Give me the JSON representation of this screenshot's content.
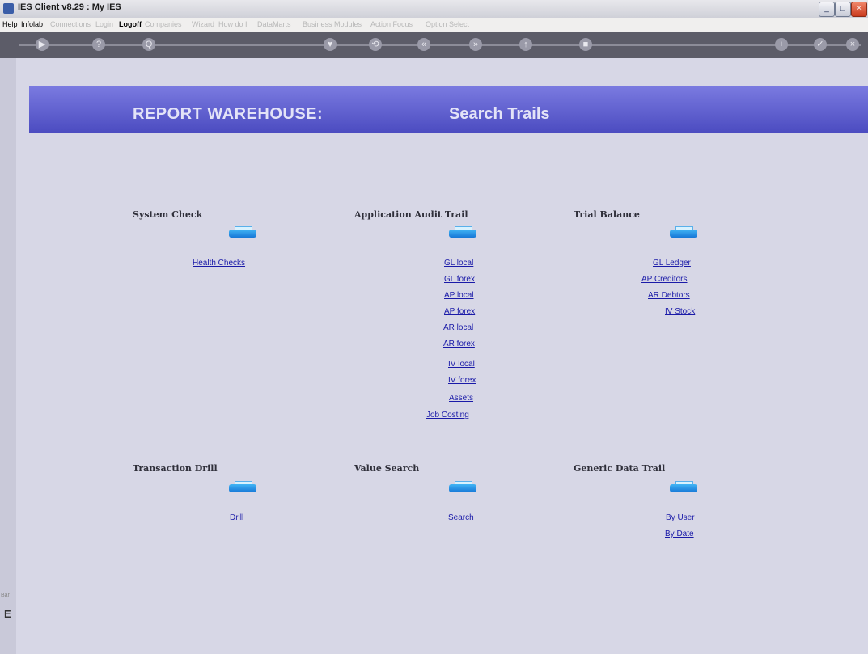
{
  "window": {
    "title": "IES Client v8.29 : My IES",
    "min_glyph": "_",
    "max_glyph": "□",
    "close_glyph": "×"
  },
  "menubar": {
    "items": [
      {
        "label": "Help",
        "enabled": true
      },
      {
        "label": "Infolab",
        "enabled": true
      },
      {
        "label": "Connections",
        "enabled": false
      },
      {
        "label": "Login",
        "enabled": false
      },
      {
        "label": "Logoff",
        "enabled": true
      },
      {
        "label": "Companies",
        "enabled": false
      },
      {
        "label": "Wizard",
        "enabled": false
      },
      {
        "label": "How do I",
        "enabled": false
      },
      {
        "label": "DataMarts",
        "enabled": false
      },
      {
        "label": "Business Modules",
        "enabled": false
      },
      {
        "label": "Action Focus",
        "enabled": false
      },
      {
        "label": "Option Select",
        "enabled": false
      }
    ]
  },
  "toolbar": {
    "icons": [
      "back-arrow-icon",
      "help-icon",
      "search-icon",
      "heart-icon",
      "refresh-icon",
      "rewind-icon",
      "forward-icon",
      "up-icon",
      "stop-icon",
      "plus-icon",
      "check-icon",
      "close-icon"
    ],
    "glyphs": [
      "▶",
      "?",
      "Q",
      "♥",
      "⟲",
      "«",
      "»",
      "↑",
      "■",
      "+",
      "✓",
      "×"
    ]
  },
  "header": {
    "title": "REPORT WAREHOUSE:",
    "subtitle": "Search Trails",
    "band_color": "#5a5ad0"
  },
  "sections": {
    "system_check": {
      "title": "System Check",
      "links": [
        "Health Checks"
      ]
    },
    "app_audit": {
      "title": "Application Audit Trail",
      "links": [
        "GL local",
        "GL forex",
        "AP local",
        "AP forex",
        "AR local",
        "AR forex",
        "IV local",
        "IV forex",
        "Assets",
        "Job Costing"
      ]
    },
    "trial_balance": {
      "title": "Trial Balance",
      "links": [
        "GL Ledger",
        "AP Creditors",
        "AR Debtors",
        "IV Stock"
      ]
    },
    "transaction_drill": {
      "title": "Transaction Drill",
      "links": [
        "Drill"
      ]
    },
    "value_search": {
      "title": "Value Search",
      "links": [
        "Search"
      ]
    },
    "generic_data": {
      "title": "Generic Data Trail",
      "links": [
        "By User",
        "By Date"
      ]
    }
  },
  "footer": {
    "glyph": "E",
    "tab_label": "Bar"
  }
}
